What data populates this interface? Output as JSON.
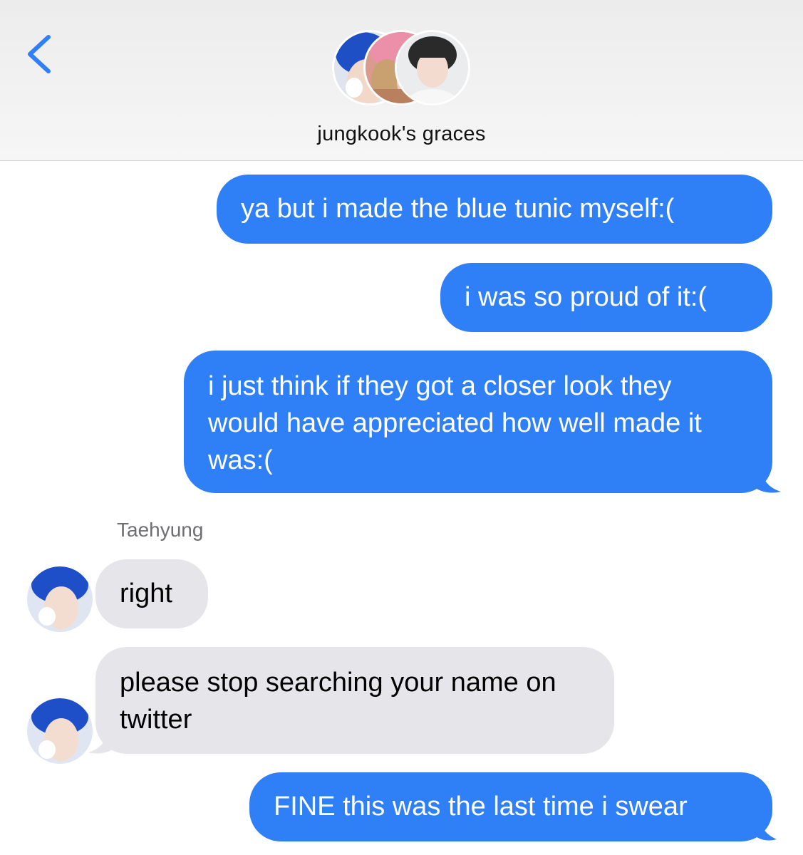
{
  "header": {
    "back_icon": "chevron-left-icon",
    "group_name": "jungkook's graces",
    "participants": [
      "blue-haired member",
      "pink-haired member",
      "jungkook"
    ]
  },
  "colors": {
    "sent_bubble": "#2f7ff6",
    "received_bubble": "#e6e6ea",
    "accent": "#2f7ff6"
  },
  "messages": [
    {
      "direction": "sent",
      "text": "ya but i made the blue tunic myself:("
    },
    {
      "direction": "sent",
      "text": "i was so proud of it:("
    },
    {
      "direction": "sent",
      "text": "i just think if they got a closer look they would have appreciated how well made it was:("
    },
    {
      "direction": "received",
      "sender": "Taehyung",
      "text": "right"
    },
    {
      "direction": "received",
      "sender": "Taehyung",
      "text": "please stop searching your name on twitter"
    },
    {
      "direction": "sent",
      "text": "FINE this was the last time i swear"
    }
  ]
}
